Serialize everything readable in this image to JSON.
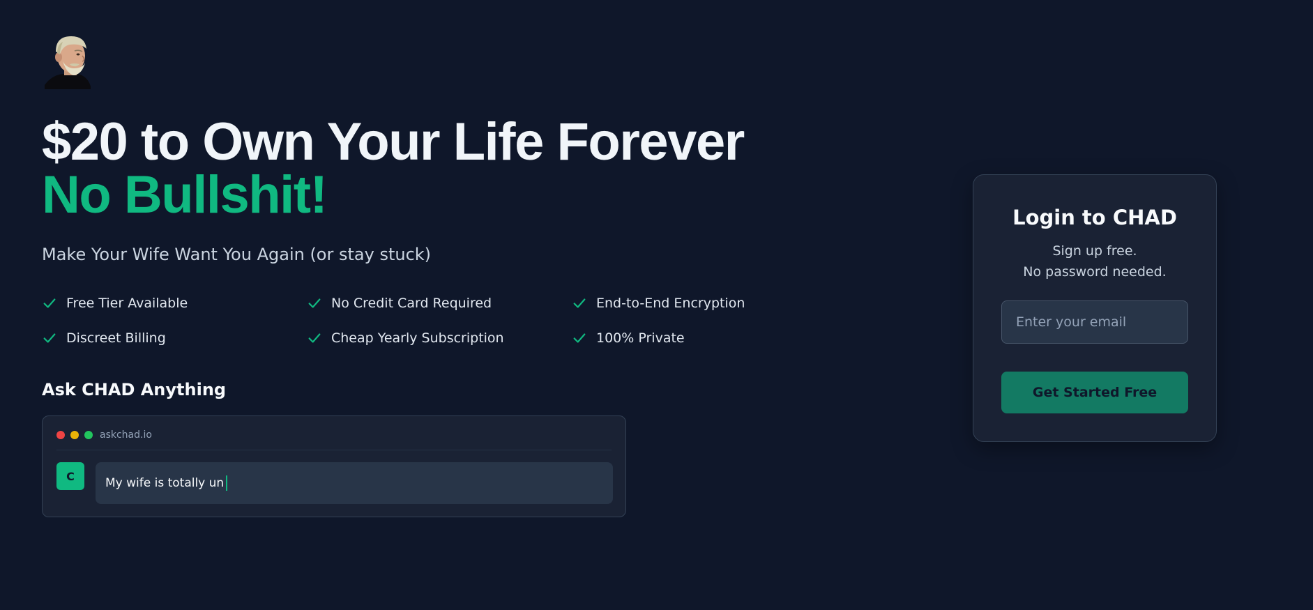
{
  "brand": {
    "avatar_icon": "bearded-man-avatar-icon"
  },
  "hero": {
    "headline_line1": "$20 to Own Your Life Forever",
    "headline_line2": "No Bullshit!",
    "subheadline": "Make Your Wife Want You Again (or stay stuck)",
    "accent_color": "#10b981"
  },
  "features": [
    {
      "label": "Free Tier Available",
      "icon": "check-icon"
    },
    {
      "label": "No Credit Card Required",
      "icon": "check-icon"
    },
    {
      "label": "End-to-End Encryption",
      "icon": "check-icon"
    },
    {
      "label": "Discreet Billing",
      "icon": "check-icon"
    },
    {
      "label": "Cheap Yearly Subscription",
      "icon": "check-icon"
    },
    {
      "label": "100% Private",
      "icon": "check-icon"
    }
  ],
  "ask": {
    "title": "Ask CHAD Anything",
    "window_url": "askchad.io",
    "avatar_letter": "C",
    "message": "My wife is totally un"
  },
  "login": {
    "title": "Login to CHAD",
    "subtitle_line1": "Sign up free.",
    "subtitle_line2": "No password needed.",
    "email_placeholder": "Enter your email",
    "email_value": "",
    "cta_label": "Get Started Free"
  }
}
